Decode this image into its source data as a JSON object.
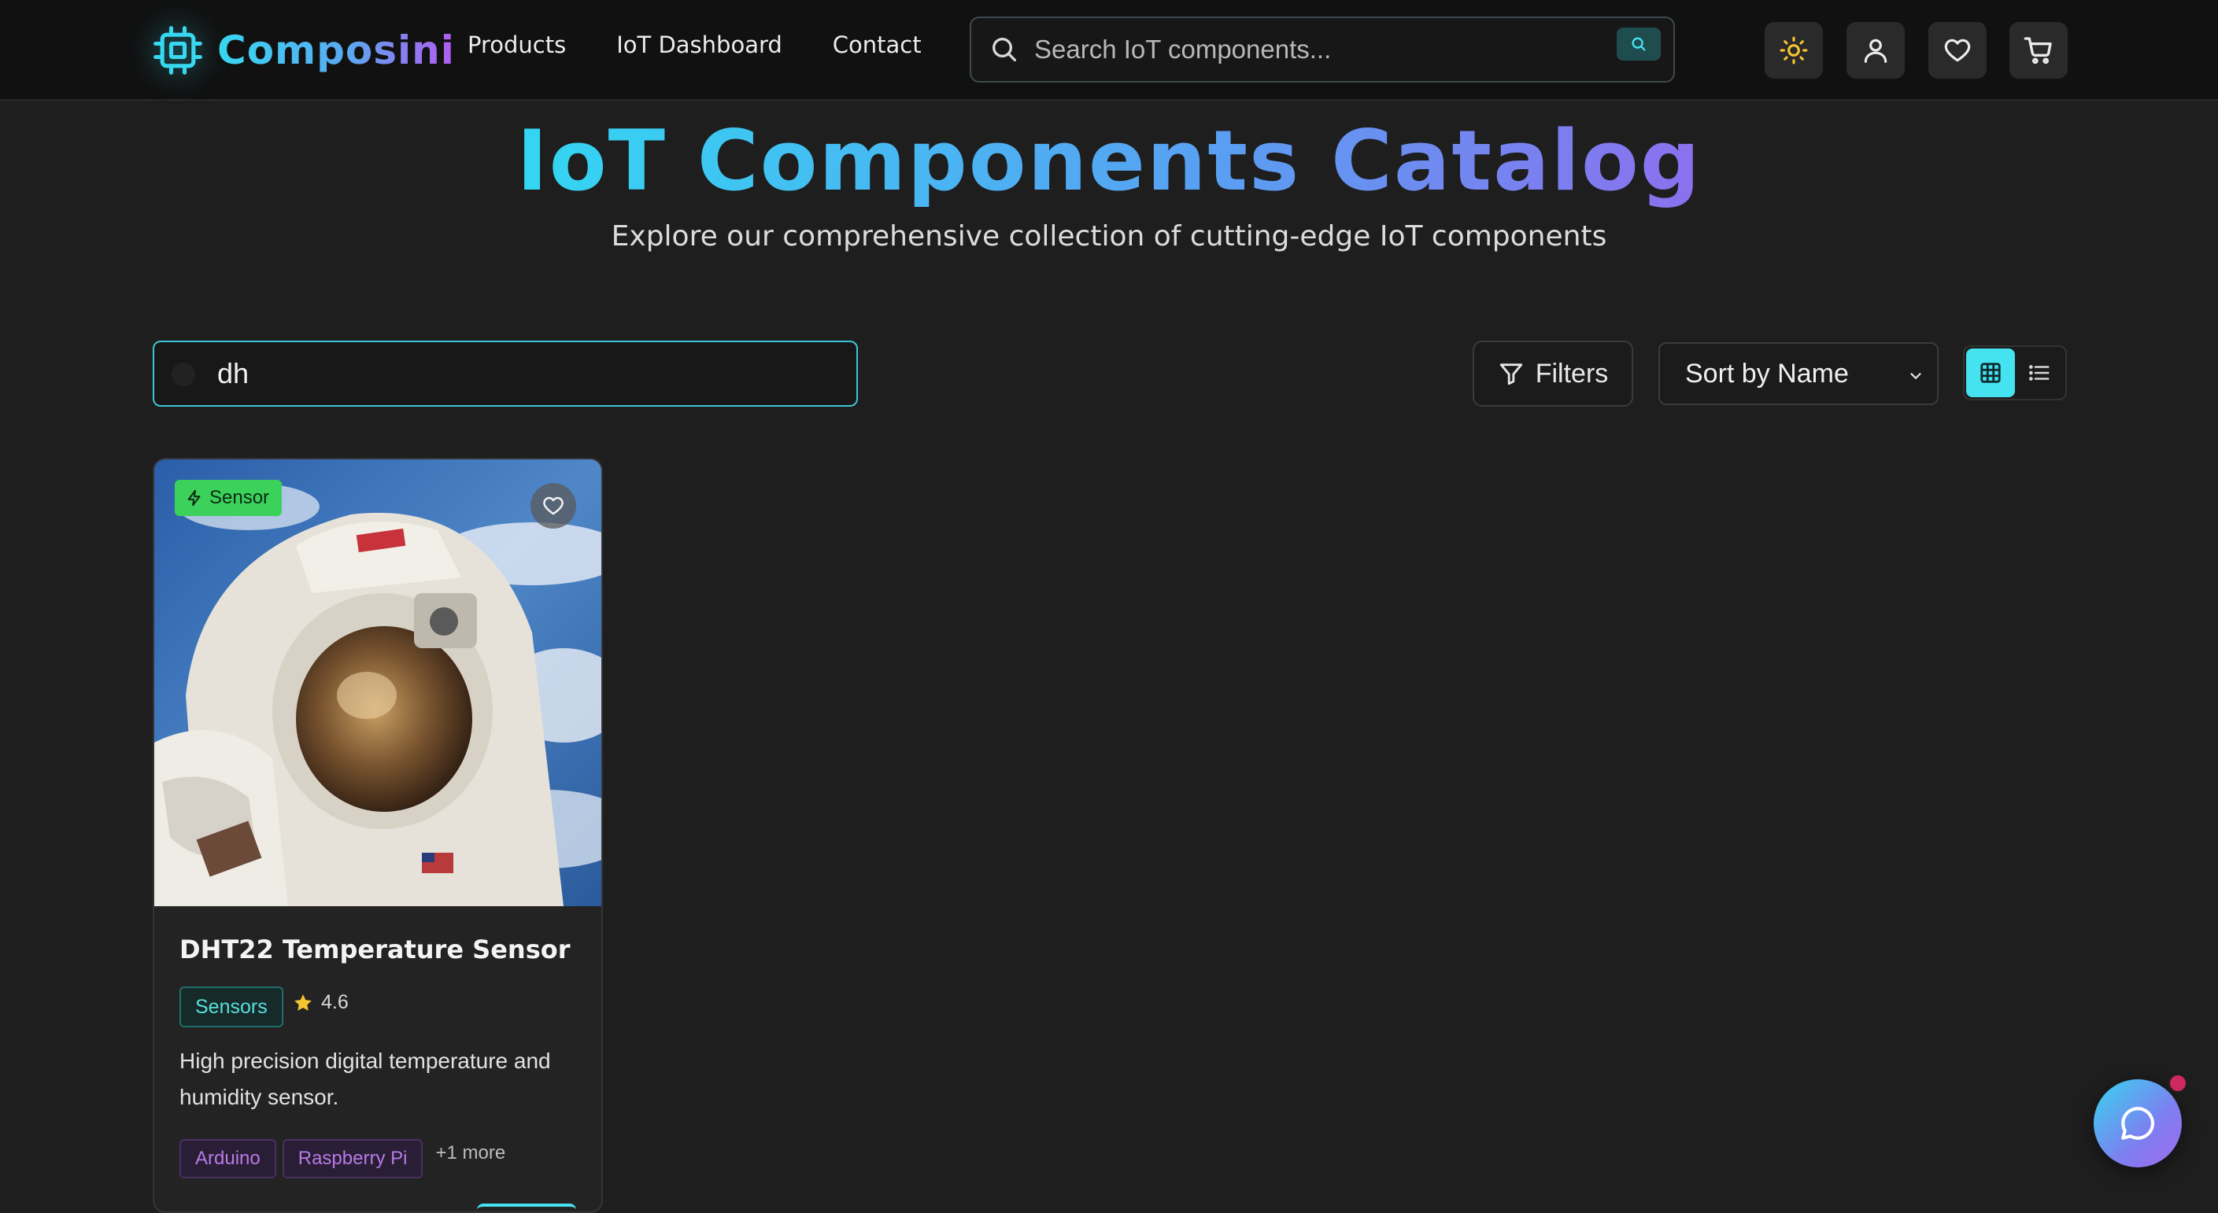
{
  "brand": {
    "name": "Composini"
  },
  "nav": {
    "items": [
      {
        "label": "Products"
      },
      {
        "label": "IoT Dashboard"
      },
      {
        "label": "Contact"
      }
    ]
  },
  "header_search": {
    "placeholder": "Search IoT components...",
    "value": ""
  },
  "header_icons": [
    "sun-icon",
    "user-icon",
    "heart-icon",
    "cart-icon"
  ],
  "hero": {
    "title": "IoT Components Catalog",
    "subtitle": "Explore our comprehensive collection of cutting-edge IoT components"
  },
  "toolbar": {
    "search_value": "dh",
    "filters_label": "Filters",
    "sort_selected": "Sort by Name",
    "view_mode": "grid"
  },
  "products": [
    {
      "badge": "Sensor",
      "title": "DHT22 Temperature Sensor",
      "category": "Sensors",
      "rating": "4.6",
      "description": "High precision digital temperature and humidity sensor.",
      "tags": [
        "Arduino",
        "Raspberry Pi"
      ],
      "more": "+1 more"
    }
  ],
  "colors": {
    "accent": "#45e2ef",
    "badge_green": "#3bd15a",
    "tag_purple": "#b77ae6",
    "category_teal": "#58e0dc",
    "background": "#1e1e1e",
    "header_bg": "#111111",
    "notification": "#cc2a5e"
  }
}
